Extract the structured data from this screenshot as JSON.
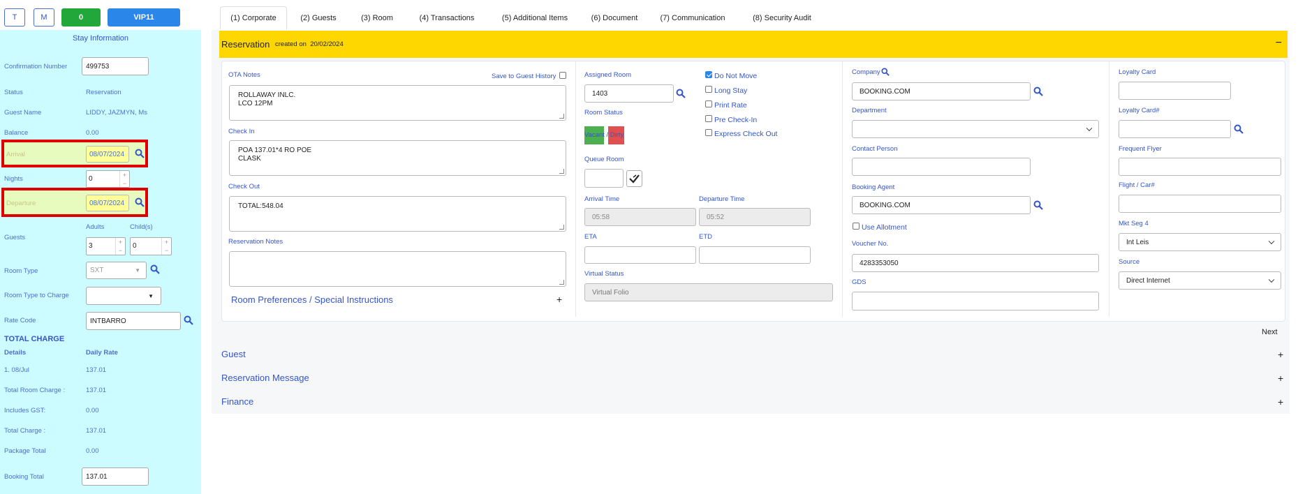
{
  "toolbar": {
    "t_label": "T",
    "m_label": "M",
    "count_label": "0",
    "vip_label": "VIP11"
  },
  "tabs": [
    {
      "label": "(1) Corporate"
    },
    {
      "label": "(2) Guests"
    },
    {
      "label": "(3) Room"
    },
    {
      "label": "(4) Transactions"
    },
    {
      "label": "(5) Additional Items"
    },
    {
      "label": "(6) Document"
    },
    {
      "label": "(7) Communication"
    },
    {
      "label": "(8) Security Audit"
    }
  ],
  "stay": {
    "title": "Stay Information",
    "confirmation_label": "Confirmation Number",
    "confirmation_value": "499753",
    "status_label": "Status",
    "status_value": "Reservation",
    "guest_name_label": "Guest Name",
    "guest_name_value": "LIDDY, JAZMYN, Ms",
    "balance_label": "Balance",
    "balance_value": "0.00",
    "arrival_label": "Arrival",
    "arrival_value": "08/07/2024",
    "nights_label": "Nights",
    "nights_value": "0",
    "departure_label": "Departure",
    "departure_value": "08/07/2024",
    "adults_label": "Adults",
    "childs_label": "Child(s)",
    "guests_label": "Guests",
    "adults_value": "3",
    "childs_value": "0",
    "room_type_label": "Room Type",
    "room_type_value": "SXT",
    "room_type_charge_label": "Room Type to Charge",
    "rate_code_label": "Rate Code",
    "rate_code_value": "INTBARRO",
    "total_charge_label": "TOTAL CHARGE",
    "details_label": "Details",
    "daily_rate_label": "Daily Rate",
    "detail_row_label": "1. 08/Jul",
    "detail_row_value": "137.01",
    "total_room_charge_label": "Total Room Charge :",
    "total_room_charge_value": "137.01",
    "includes_gst_label": "Includes GST:",
    "includes_gst_value": "0.00",
    "total_charge_row_label": "Total Charge :",
    "total_charge_row_value": "137.01",
    "package_total_label": "Package Total",
    "package_total_value": "0.00",
    "booking_total_label": "Booking Total",
    "booking_total_value": "137.01"
  },
  "reservation": {
    "title": "Reservation",
    "created_on_label": "created on",
    "created_on_value": "20/02/2024",
    "collapse_symbol": "−",
    "ota_notes_label": "OTA Notes",
    "save_history_label": "Save to Guest History",
    "ota_notes_value": "ROLLAWAY INLC.\nLCO 12PM",
    "check_in_label": "Check In",
    "check_in_value": "POA 137.01*4 RO POE\nCLASK",
    "check_out_label": "Check Out",
    "check_out_value": "TOTAL:548.04",
    "reservation_notes_label": "Reservation Notes",
    "room_prefs_label": "Room Preferences / Special Instructions",
    "assigned_room_label": "Assigned Room",
    "assigned_room_value": "1403",
    "room_status_label": "Room Status",
    "room_status_text": "Vacant / Dirty",
    "queue_room_label": "Queue Room",
    "arrival_time_label": "Arrival Time",
    "arrival_time_value": "05:58",
    "departure_time_label": "Departure Time",
    "departure_time_value": "05:52",
    "eta_label": "ETA",
    "etd_label": "ETD",
    "virtual_status_label": "Virtual Status",
    "virtual_status_value": "Virtual Folio",
    "do_not_move_label": "Do Not Move",
    "long_stay_label": "Long Stay",
    "print_rate_label": "Print Rate",
    "pre_checkin_label": "Pre Check-In",
    "express_checkout_label": "Express Check Out",
    "company_label": "Company",
    "company_value": "BOOKING.COM",
    "department_label": "Department",
    "contact_person_label": "Contact Person",
    "booking_agent_label": "Booking Agent",
    "booking_agent_value": "BOOKING.COM",
    "use_allotment_label": "Use Allotment",
    "voucher_label": "Voucher No.",
    "voucher_value": "4283353050",
    "gds_label": "GDS",
    "loyalty_card_label": "Loyalty Card",
    "loyalty_card_num_label": "Loyalty Card#",
    "frequent_flyer_label": "Frequent Flyer",
    "flight_car_label": "Flight / Car#",
    "mkt_seg_label": "Mkt Seg 4",
    "mkt_seg_value": "Int Leis",
    "source_label": "Source",
    "source_value": "Direct Internet",
    "next_label": "Next"
  },
  "sections": {
    "guest_label": "Guest",
    "message_label": "Reservation Message",
    "finance_label": "Finance",
    "expand_symbol": "+"
  }
}
